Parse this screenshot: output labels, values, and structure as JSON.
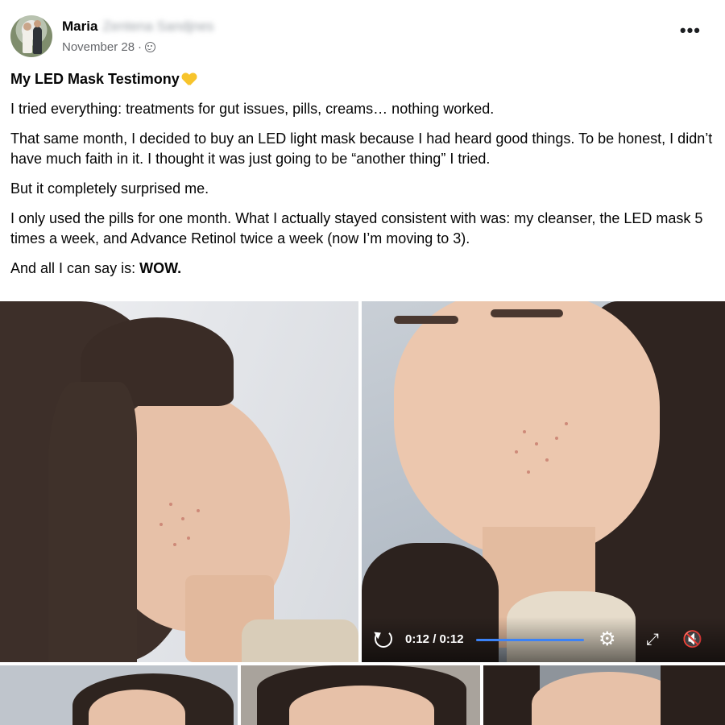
{
  "author": {
    "first_name": "Maria",
    "blurred_surname": "Zentena Sandjnes",
    "date": "November 28",
    "date_sep": "·",
    "audience_icon": "globe-icon"
  },
  "menu": {
    "more_label": "•••"
  },
  "post": {
    "title": "My LED Mask Testimony",
    "paragraphs": [
      "I tried everything: treatments for gut issues, pills, creams… nothing worked.",
      "That same month, I decided to buy an LED light mask because I had heard good things. To be honest, I didn’t have much faith in it. I thought it was just going to be “another thing” I tried.",
      "But it completely surprised me.",
      "I only used the pills for one month. What I actually stayed consistent with was: my cleanser, the LED mask 5 times a week, and Advance Retinol twice a week (now I’m moving to 3)."
    ],
    "closing_prefix": "And all I can say is: ",
    "closing_emphasis": "WOW."
  },
  "video": {
    "time": "0:12 / 0:12",
    "progress": 1.0,
    "progress_color": "#3b82f6",
    "icons": [
      "replay-icon",
      "gear-icon",
      "expand-icon",
      "mute-icon"
    ]
  },
  "colors": {
    "secondary_text": "#65676b",
    "accent": "#3b82f6"
  }
}
